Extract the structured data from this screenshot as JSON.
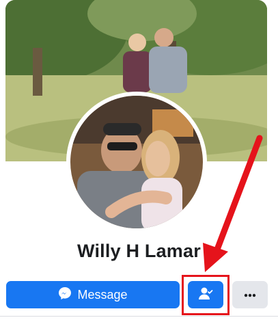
{
  "profile": {
    "name": "Willy H Lamar"
  },
  "actions": {
    "message_label": "Message",
    "message_icon": "messenger-icon",
    "friends_icon": "friends-check-icon",
    "more_icon": "more-dots-icon"
  },
  "annotation": {
    "highlight_color": "#e5131b"
  },
  "colors": {
    "accent": "#1877f2",
    "secondary_button": "#e4e6eb"
  }
}
